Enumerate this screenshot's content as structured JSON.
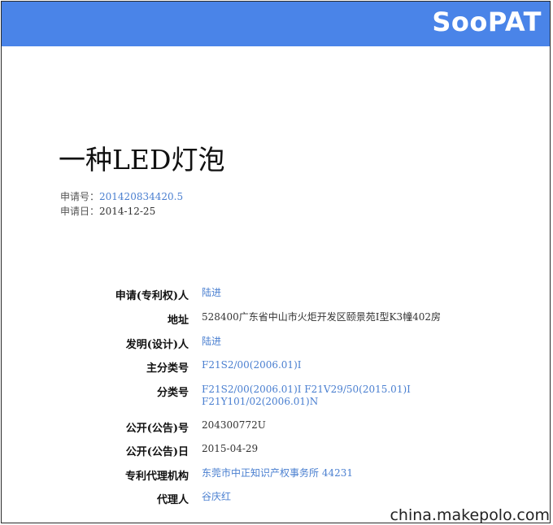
{
  "header": {
    "logo_text": "SooPAT"
  },
  "patent": {
    "title": "一种LED灯泡",
    "application_number_label": "申请号：",
    "application_number": "201420834420.5",
    "application_date_label": "申请日：",
    "application_date": "2014-12-25"
  },
  "fields": {
    "applicant": {
      "label": "申请(专利权)人",
      "value": "陆进"
    },
    "address": {
      "label": "地址",
      "value": "528400广东省中山市火炬开发区颐景苑I型K3幢402房"
    },
    "inventor": {
      "label": "发明(设计)人",
      "value": "陆进"
    },
    "main_class": {
      "label": "主分类号",
      "value": "F21S2/00(2006.01)I"
    },
    "classes": {
      "label": "分类号",
      "line1": "F21S2/00(2006.01)I F21V29/50(2015.01)I",
      "line2": "F21Y101/02(2006.01)N"
    },
    "pub_number": {
      "label": "公开(公告)号",
      "value": "204300772U"
    },
    "pub_date": {
      "label": "公开(公告)日",
      "value": "2015-04-29"
    },
    "agency": {
      "label": "专利代理机构",
      "value": "东莞市中正知识产权事务所 44231"
    },
    "agent": {
      "label": "代理人",
      "value": "谷庆红"
    }
  },
  "watermark": "china.makepolo.com",
  "colors": {
    "header_bg": "#4a84e8",
    "link": "#4a7fd0"
  }
}
